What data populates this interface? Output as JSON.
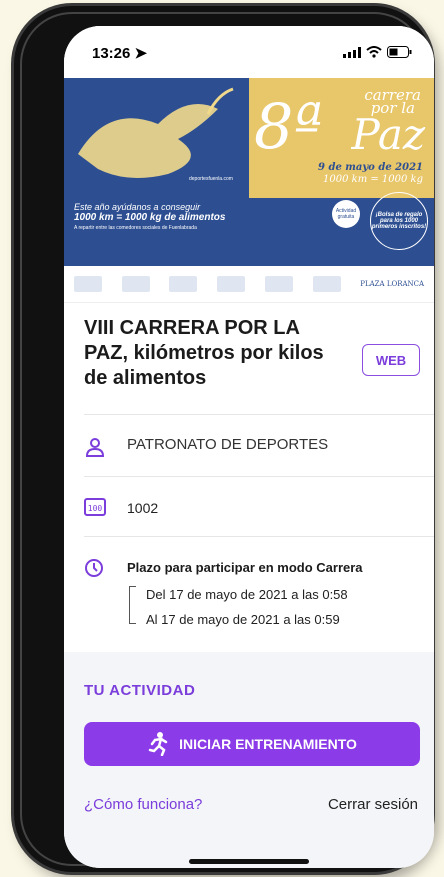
{
  "status_bar": {
    "time": "13:26"
  },
  "banner": {
    "big_number": "8ª",
    "title_line1": "carrera",
    "title_line2": "por la",
    "title_word": "Paz",
    "date": "9 de mayo de 2021",
    "tagline": "1000 km = 1000 kg",
    "help_line1": "Este año ayúdanos a conseguir",
    "help_line2": "1000 km = 1000 kg de alimentos",
    "help_line3": "A repartir entre las comedores sociales de Fuenlabrada",
    "site": "deportesfuenla.com",
    "gift_text": "¡Bolsa de regalo para los 1000 primeros inscritos!",
    "badge_text": "Actividad gratuita"
  },
  "sponsors": {
    "right": "PLAZA LORANCA"
  },
  "event": {
    "title": "VIII CARRERA POR LA PAZ, kilómetros por kilos de alimentos",
    "web_label": "WEB",
    "organizer": "PATRONATO DE DEPORTES",
    "number": "1002",
    "period_label": "Plazo para participar en modo Carrera",
    "from": "Del 17 de mayo de 2021 a las 0:58",
    "to": "Al 17 de mayo de 2021 a las 0:59"
  },
  "activity": {
    "heading": "TU ACTIVIDAD",
    "start_label": "INICIAR ENTRENAMIENTO",
    "how_label": "¿Cómo funciona?",
    "logout_label": "Cerrar sesión"
  },
  "colors": {
    "accent": "#8c3be8",
    "banner_blue": "#2d4f92",
    "banner_yellow": "#e8c66a"
  }
}
